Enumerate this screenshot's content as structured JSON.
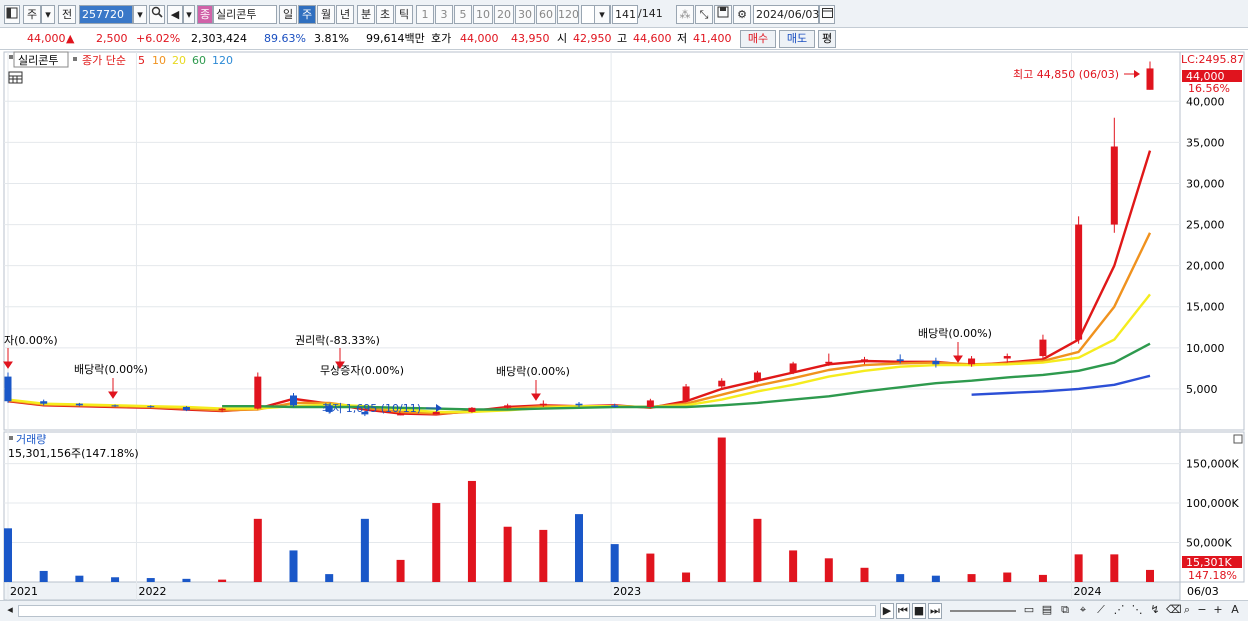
{
  "toolbar": {
    "market_label": "주",
    "prev_label": "전",
    "stock_code": "257720",
    "stock_badge": "종",
    "stock_name": "실리콘투",
    "periods": [
      "일",
      "주",
      "월",
      "년",
      "분",
      "초",
      "틱"
    ],
    "active_period": "주",
    "intervals": [
      "1",
      "3",
      "5",
      "10",
      "20",
      "30",
      "60",
      "120"
    ],
    "page_current": "141",
    "page_total": "/141",
    "date": "2024/06/03"
  },
  "quote": {
    "price": "44,000",
    "change_arrow": "▲",
    "change": "2,500",
    "change_pct": "+6.02%",
    "volume": "2,303,424",
    "ratio1": "89.63%",
    "ratio2": "3.81%",
    "amount": "99,614백만",
    "bid_label": "호가",
    "ask_price": "44,000",
    "bid_price": "43,950",
    "open_label": "시",
    "open": "42,950",
    "high_label": "고",
    "high": "44,600",
    "low_label": "저",
    "low": "41,400",
    "buy_label": "매수",
    "sell_label": "매도",
    "eval_label": "평"
  },
  "legend": {
    "name": "실리콘투",
    "ma_title": "종가 단순",
    "ma_periods": [
      "5",
      "10",
      "20",
      "60",
      "120"
    ]
  },
  "price_axis": {
    "lc_label": "LC:2495.87",
    "current_label": "44,000",
    "current_pct": "16.56%",
    "ticks": [
      "40,000",
      "35,000",
      "30,000",
      "25,000",
      "20,000",
      "15,000",
      "10,000",
      "5,000"
    ]
  },
  "annotations": {
    "high_marker": "최고 44,850 (06/03)",
    "low_marker": "최저 1,695 (10/11)",
    "events": [
      "자(0.00%)",
      "배당락(0.00%)",
      "권리락(-83.33%)",
      "무상증자(0.00%)",
      "배당락(0.00%)",
      "배당락(0.00%)"
    ]
  },
  "volume_panel": {
    "title": "거래량",
    "value": "15,301,156주(147.18%)",
    "ticks": [
      "150,000K",
      "100,000K",
      "50,000K"
    ],
    "current_label": "15,301K",
    "current_pct": "147.18%"
  },
  "x_axis": {
    "labels": [
      "2021",
      "2022",
      "2023",
      "2024"
    ],
    "end_label": "06/03"
  },
  "colors": {
    "up": "#e0141e",
    "down": "#1a57c8",
    "ma5": "#e01818",
    "ma10": "#f0921e",
    "ma20": "#f5ec1e",
    "ma60": "#2e9a4e",
    "ma120": "#2c4fd6"
  },
  "chart_data": {
    "type": "candlestick",
    "title": "실리콘투",
    "x_start": "2021",
    "x_end": "2024-06-03",
    "x_ticks": [
      "2021",
      "2022",
      "2023",
      "2024"
    ],
    "ylim": [
      0,
      46000
    ],
    "volume_ylim": [
      0,
      190000
    ],
    "volume_unit": "K shares",
    "series": [
      {
        "name": "종가 5",
        "values": [
          3500,
          3000,
          2900,
          2800,
          2700,
          2500,
          2300,
          2600,
          3800,
          3200,
          2500,
          2000,
          1900,
          2300,
          2800,
          3000,
          2900,
          3000,
          2700,
          3500,
          5000,
          6000,
          7000,
          8000,
          8400,
          8300,
          8300,
          7900,
          8200,
          8600,
          11000,
          20000,
          34000
        ]
      },
      {
        "name": "종가 10",
        "values": [
          3600,
          3100,
          3000,
          2900,
          2800,
          2600,
          2400,
          2500,
          3300,
          3300,
          2700,
          2200,
          2000,
          2200,
          2600,
          2900,
          2900,
          2900,
          2800,
          3200,
          4300,
          5400,
          6300,
          7300,
          7900,
          8100,
          8200,
          8000,
          8100,
          8400,
          9500,
          15000,
          24000
        ]
      },
      {
        "name": "종가 20",
        "values": [
          3700,
          3200,
          3100,
          3000,
          2900,
          2800,
          2600,
          2600,
          2900,
          3100,
          2900,
          2500,
          2200,
          2200,
          2400,
          2700,
          2900,
          2900,
          2800,
          3000,
          3700,
          4700,
          5500,
          6500,
          7200,
          7700,
          7900,
          7900,
          8000,
          8200,
          8800,
          11000,
          16500
        ]
      },
      {
        "name": "종가 60",
        "values": [
          null,
          null,
          null,
          null,
          null,
          null,
          2900,
          2900,
          2800,
          2800,
          2800,
          2700,
          2600,
          2500,
          2500,
          2600,
          2700,
          2800,
          2800,
          2800,
          3000,
          3300,
          3700,
          4100,
          4700,
          5200,
          5700,
          6000,
          6400,
          6700,
          7200,
          8200,
          10500
        ]
      },
      {
        "name": "종가 120",
        "values": [
          null,
          null,
          null,
          null,
          null,
          null,
          null,
          null,
          null,
          null,
          null,
          null,
          null,
          null,
          null,
          null,
          null,
          null,
          null,
          null,
          null,
          null,
          null,
          null,
          null,
          null,
          null,
          4300,
          4500,
          4700,
          5000,
          5500,
          6600
        ]
      }
    ],
    "candles": [
      {
        "o": 6500,
        "h": 7000,
        "c": 3500,
        "l": 3300
      },
      {
        "o": 3500,
        "h": 3700,
        "c": 3200,
        "l": 3000
      },
      {
        "o": 3200,
        "h": 3300,
        "c": 3000,
        "l": 2900
      },
      {
        "o": 3000,
        "h": 3100,
        "c": 2900,
        "l": 2800
      },
      {
        "o": 2900,
        "h": 3000,
        "c": 2800,
        "l": 2700
      },
      {
        "o": 2800,
        "h": 2900,
        "c": 2400,
        "l": 2300
      },
      {
        "o": 2400,
        "h": 2700,
        "c": 2600,
        "l": 2200
      },
      {
        "o": 2600,
        "h": 7000,
        "c": 6500,
        "l": 2500
      },
      {
        "o": 4200,
        "h": 4500,
        "c": 3000,
        "l": 2800
      },
      {
        "o": 3000,
        "h": 3200,
        "c": 2200,
        "l": 2000
      },
      {
        "o": 2200,
        "h": 2300,
        "c": 1900,
        "l": 1695
      },
      {
        "o": 1900,
        "h": 2100,
        "c": 1900,
        "l": 1800
      },
      {
        "o": 1900,
        "h": 2300,
        "c": 2200,
        "l": 1900
      },
      {
        "o": 2200,
        "h": 2800,
        "c": 2700,
        "l": 2100
      },
      {
        "o": 2700,
        "h": 3200,
        "c": 3000,
        "l": 2600
      },
      {
        "o": 3000,
        "h": 3600,
        "c": 3200,
        "l": 2800
      },
      {
        "o": 3200,
        "h": 3400,
        "c": 3000,
        "l": 2800
      },
      {
        "o": 3000,
        "h": 3200,
        "c": 2800,
        "l": 2700
      },
      {
        "o": 2800,
        "h": 3800,
        "c": 3600,
        "l": 2700
      },
      {
        "o": 3600,
        "h": 5600,
        "c": 5300,
        "l": 3400
      },
      {
        "o": 5300,
        "h": 6300,
        "c": 6000,
        "l": 5000
      },
      {
        "o": 6000,
        "h": 7200,
        "c": 7000,
        "l": 5800
      },
      {
        "o": 7000,
        "h": 8300,
        "c": 8100,
        "l": 6800
      },
      {
        "o": 8100,
        "h": 9300,
        "c": 8300,
        "l": 7800
      },
      {
        "o": 8300,
        "h": 8900,
        "c": 8600,
        "l": 8000
      },
      {
        "o": 8600,
        "h": 9200,
        "c": 8400,
        "l": 8100
      },
      {
        "o": 8400,
        "h": 8800,
        "c": 8000,
        "l": 7600
      },
      {
        "o": 8000,
        "h": 9000,
        "c": 8700,
        "l": 7700
      },
      {
        "o": 8700,
        "h": 9300,
        "c": 9000,
        "l": 8200
      },
      {
        "o": 9000,
        "h": 11600,
        "c": 11000,
        "l": 8600
      },
      {
        "o": 11000,
        "h": 26000,
        "c": 25000,
        "l": 10500
      },
      {
        "o": 25000,
        "h": 38000,
        "c": 34500,
        "l": 24000
      },
      {
        "o": 41400,
        "h": 44850,
        "c": 44000,
        "l": 41400
      }
    ],
    "volume": [
      68000,
      14000,
      8000,
      6000,
      5000,
      4000,
      3000,
      80000,
      40000,
      10000,
      80000,
      28000,
      100000,
      128000,
      70000,
      66000,
      86000,
      48000,
      36000,
      12000,
      183000,
      80000,
      40000,
      30000,
      18000,
      10000,
      8000,
      10000,
      12000,
      9000,
      35000,
      35000,
      15301
    ]
  },
  "bottom_bar": {
    "nav_labels": [
      "▶",
      "⏮",
      "■",
      "⏭"
    ]
  }
}
